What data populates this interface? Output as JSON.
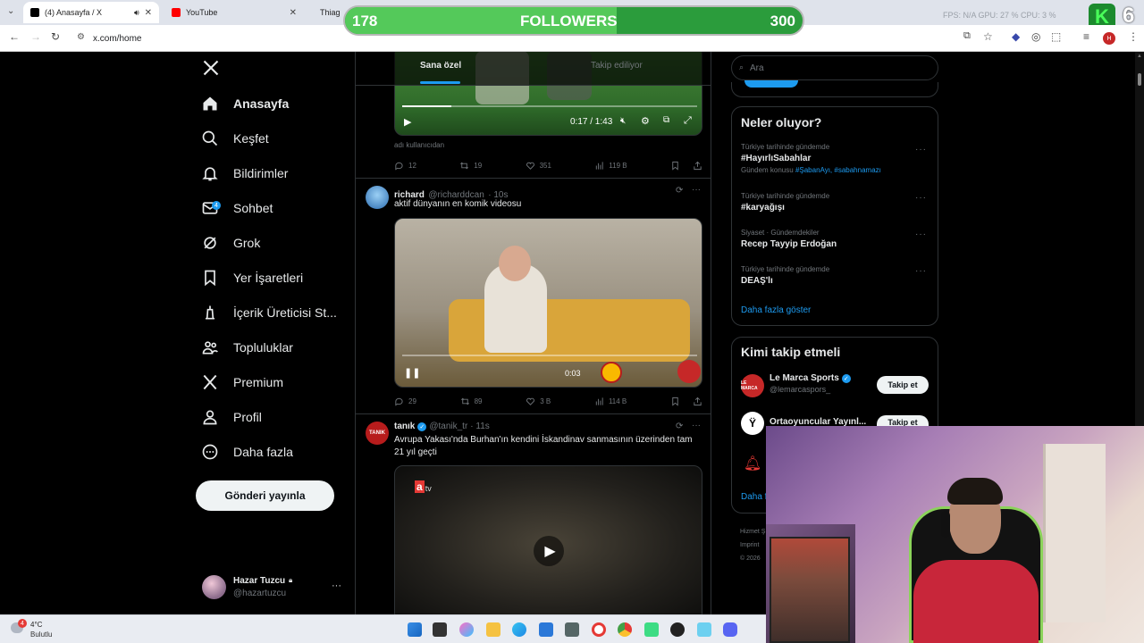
{
  "browser": {
    "tabs": [
      {
        "title": "(4) Anasayfa / X",
        "active": true
      },
      {
        "title": "YouTube",
        "active": false
      },
      {
        "title": "Thiag",
        "active": false
      }
    ],
    "url": "x.com/home"
  },
  "stream_overlay": {
    "label": "FOLLOWERS",
    "current": "178",
    "goal": "300",
    "progress_fraction": 0.593,
    "status_text": "FPS: N/A  GPU: 27 %  CPU: 3 %",
    "corner_number": "6",
    "corner_logo": "K"
  },
  "sidebar": {
    "logo": "X",
    "items": [
      {
        "label": "Anasayfa",
        "icon": "home-icon",
        "active": true
      },
      {
        "label": "Keşfet",
        "icon": "search-icon"
      },
      {
        "label": "Bildirimler",
        "icon": "bell-icon"
      },
      {
        "label": "Sohbet",
        "icon": "mail-icon",
        "badge": "4"
      },
      {
        "label": "Grok",
        "icon": "grok-icon"
      },
      {
        "label": "Yer İşaretleri",
        "icon": "bookmark-icon"
      },
      {
        "label": "İçerik Üreticisi St...",
        "icon": "creator-icon"
      },
      {
        "label": "Topluluklar",
        "icon": "communities-icon"
      },
      {
        "label": "Premium",
        "icon": "x-premium-icon"
      },
      {
        "label": "Profil",
        "icon": "profile-icon"
      },
      {
        "label": "Daha fazla",
        "icon": "more-circle-icon"
      }
    ],
    "post_button": "Gönderi yayınla",
    "account": {
      "name": "Hazar Tuzcu",
      "handle": "@hazartuzcu"
    }
  },
  "feed": {
    "tabs": [
      "Sana özel",
      "Takip ediliyor"
    ],
    "tweets": [
      {
        "video_time": "0:17 / 1:43",
        "caption": "adı kullanıcıdan",
        "replies": "12",
        "reposts": "19",
        "likes": "351",
        "views": "119 B"
      },
      {
        "name": "richard",
        "handle": "@richarddcan",
        "time": "· 10s",
        "text": "aktif dünyanın en komik videosu",
        "video_overlay": "0:03",
        "replies": "29",
        "reposts": "89",
        "likes": "3 B",
        "views": "114 B"
      },
      {
        "name": "tanık",
        "handle": "@tanik_tr",
        "time": "· 11s",
        "avatar_text": "TANIK",
        "text_line1": "Avrupa Yakası'nda Burhan'ın kendini İskandinav sanmasının üzerinden tam",
        "text_line2": "21 yıl geçti",
        "media_logo": "a",
        "media_logo_suffix": "tv"
      }
    ]
  },
  "right": {
    "search_placeholder": "Ara",
    "trends_title": "Neler oluyor?",
    "trends": [
      {
        "category": "Türkiye tarihinde gündemde",
        "name": "#HayırlıSabahlar",
        "extra_prefix": "Gündem konusu",
        "extra_links": "#ŞabanAyı, #sabahnamazı"
      },
      {
        "category": "Türkiye tarihinde gündemde",
        "name": "#karyağışı"
      },
      {
        "category": "Siyaset · Gündemdekiler",
        "name": "Recep Tayyip Erdoğan"
      },
      {
        "category": "Türkiye tarihinde gündemde",
        "name": "DEAŞ'lı"
      }
    ],
    "show_more": "Daha fazla göster",
    "who_to_follow_title": "Kimi takip etmeli",
    "suggestions": [
      {
        "name": "Le Marca Sports",
        "handle": "@lemarcaspors_",
        "button": "Takip et",
        "avatar_text": "LE MARCA"
      },
      {
        "name": "Ortaoyuncular Yayınl...",
        "handle": "",
        "button": "Takip et"
      }
    ],
    "partial_more": "Daha f",
    "footer": [
      "Hizmet Ş",
      "Imprint",
      "© 2026"
    ]
  },
  "taskbar": {
    "weather_temp": "4°C",
    "weather_desc": "Bulutlu",
    "weather_badge": "4"
  },
  "colors": {
    "accent": "#1d9bf0",
    "bg": "#000000",
    "border": "#2f3336",
    "muted": "#71767b",
    "followers_bar": "#54c95a"
  }
}
